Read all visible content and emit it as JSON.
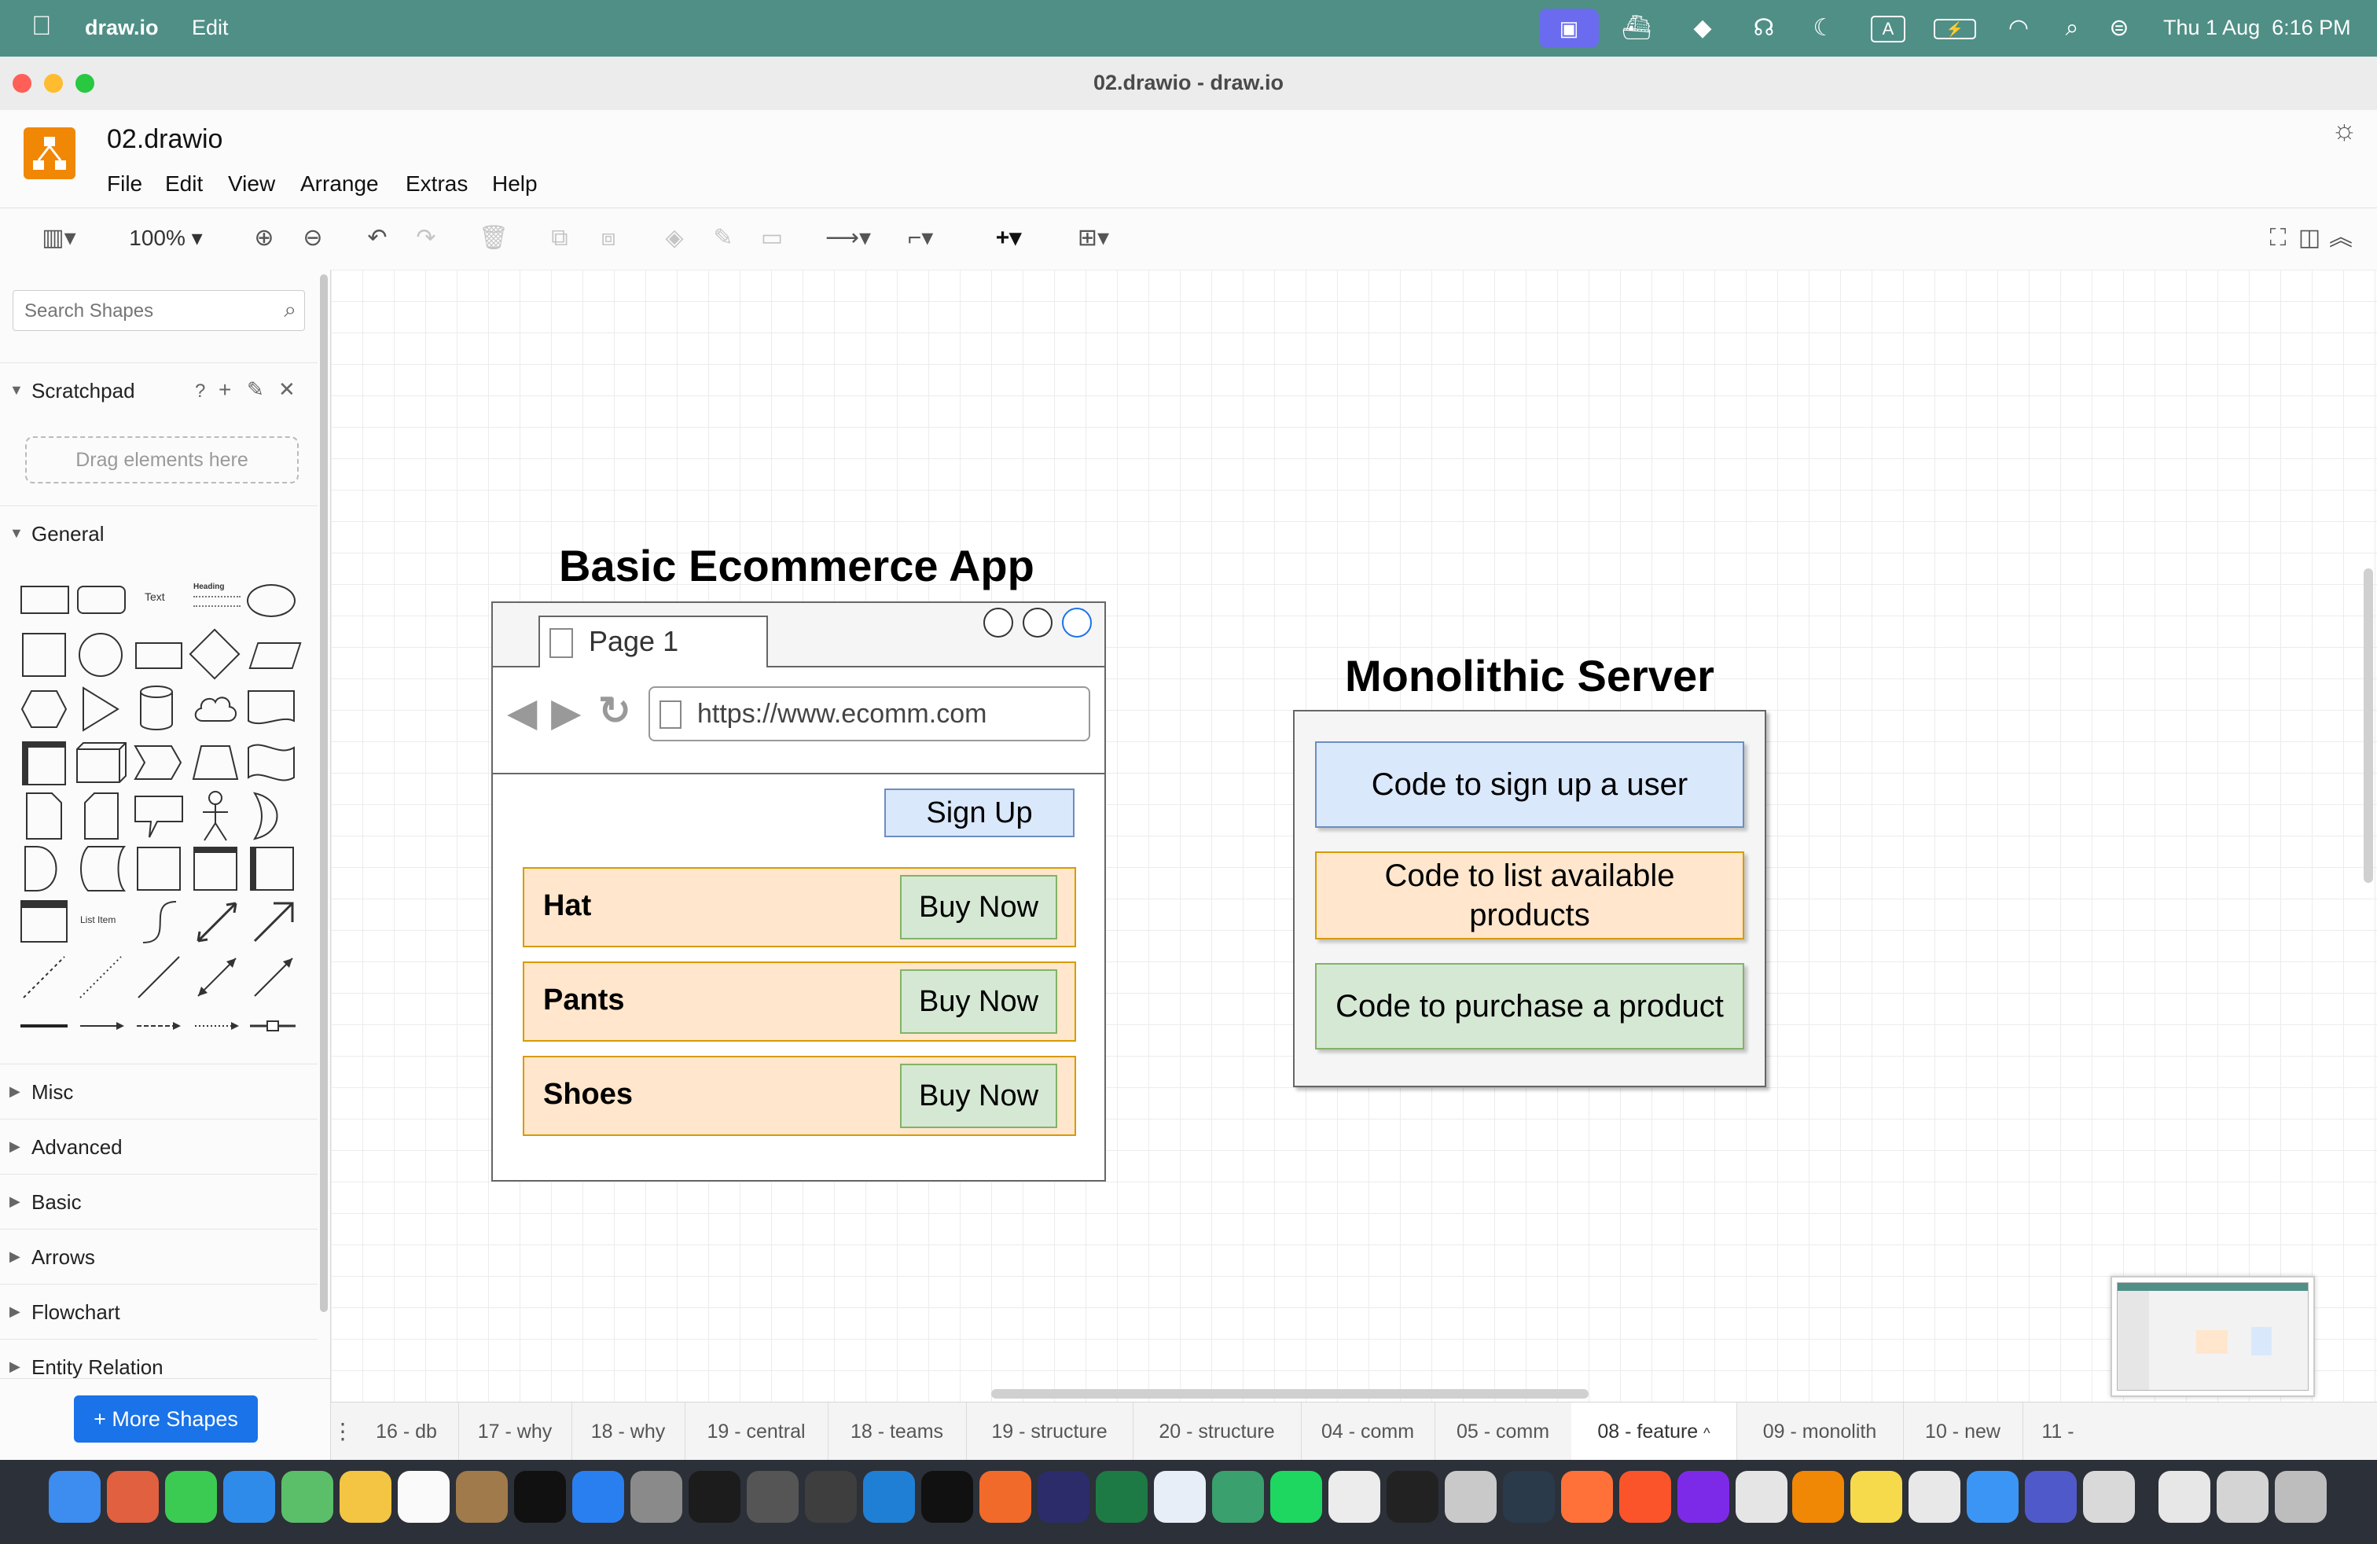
{
  "menubar": {
    "app_name": "draw.io",
    "edit_label": "Edit",
    "clock": "Thu 1 Aug  6:16 PM",
    "status_text": "A"
  },
  "window": {
    "title": "02.drawio - draw.io"
  },
  "header": {
    "file_name": "02.drawio",
    "menus": [
      "File",
      "Edit",
      "View",
      "Arrange",
      "Extras",
      "Help"
    ]
  },
  "toolbar": {
    "zoom": "100%"
  },
  "sidebar": {
    "search_placeholder": "Search Shapes",
    "scratchpad_label": "Scratchpad",
    "scratchpad_help": "?",
    "scratchpad_drop": "Drag elements here",
    "general_label": "General",
    "text_shape_label": "Text",
    "heading_shape_label": "Heading",
    "list_item_label": "List Item",
    "sections": [
      "Misc",
      "Advanced",
      "Basic",
      "Arrows",
      "Flowchart",
      "Entity Relation"
    ],
    "more_shapes": "+ More Shapes"
  },
  "diagram": {
    "ecommerce_title": "Basic Ecommerce App",
    "browser_tab": "Page 1",
    "url": "https://www.ecomm.com",
    "signup": "Sign Up",
    "products": [
      {
        "name": "Hat",
        "buy": "Buy Now"
      },
      {
        "name": "Pants",
        "buy": "Buy Now"
      },
      {
        "name": "Shoes",
        "buy": "Buy Now"
      }
    ],
    "server_title": "Monolithic Server",
    "server_items": [
      "Code to sign up a user",
      "Code to list available products",
      "Code to purchase a product"
    ]
  },
  "page_tabs": [
    "16 - db",
    "17 - why",
    "18 - why",
    "19 - central",
    "18 - teams",
    "19 - structure",
    "20 - structure",
    "04 - comm",
    "05 - comm",
    "08 - feature",
    "09 - monolith",
    "10 - new",
    "11 - "
  ],
  "active_tab": "08 - feature",
  "colors": {
    "menubar": "#4f8f86",
    "blue_fill": "#dae8fc",
    "blue_stroke": "#6c8ebf",
    "orange_fill": "#ffe6cc",
    "orange_stroke": "#d79b00",
    "green_fill": "#d5e8d4",
    "green_stroke": "#82b366",
    "accent": "#1a73e8"
  }
}
